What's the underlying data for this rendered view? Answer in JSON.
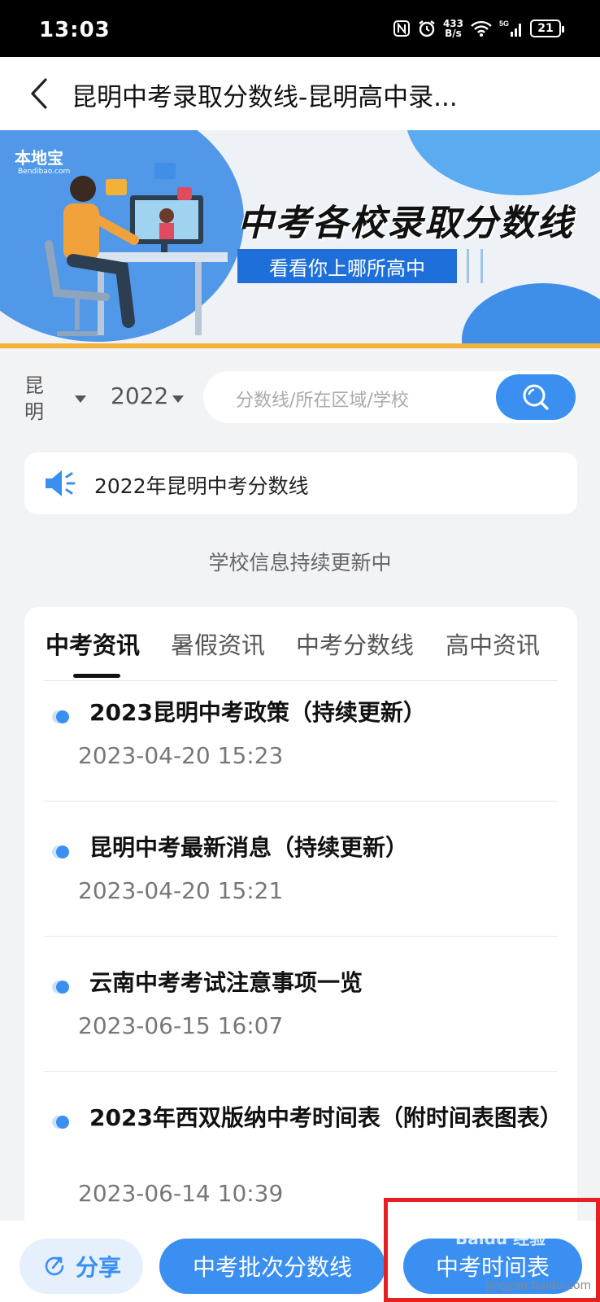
{
  "status_bar": {
    "time": "13:03",
    "net_speed_value": "433",
    "net_speed_unit": "B/s",
    "network": "5G",
    "battery": "21"
  },
  "header": {
    "title": "昆明中考录取分数线-昆明高中录..."
  },
  "banner": {
    "logo": "本地宝",
    "logo_sub": "Bendibao.com",
    "headline": "中考各校录取分数线",
    "subheadline": "看看你上哪所高中",
    "colors": {
      "primary": "#3a8ff0",
      "accent_stripe": "#f2b23a"
    }
  },
  "filters": {
    "city": "昆明",
    "year": "2022",
    "search_placeholder": "分数线/所在区域/学校"
  },
  "notice": {
    "text": "2022年昆明中考分数线"
  },
  "updating_text": "学校信息持续更新中",
  "tabs": [
    {
      "label": "中考资讯",
      "active": true
    },
    {
      "label": "暑假资讯",
      "active": false
    },
    {
      "label": "中考分数线",
      "active": false
    },
    {
      "label": "高中资讯",
      "active": false
    }
  ],
  "news": [
    {
      "title": "2023昆明中考政策（持续更新）",
      "date": "2023-04-20 15:23"
    },
    {
      "title": "昆明中考最新消息（持续更新）",
      "date": "2023-04-20 15:21"
    },
    {
      "title": "云南中考考试注意事项一览",
      "date": "2023-06-15 16:07"
    },
    {
      "title": "2023年西双版纳中考时间表（附时间表图表）",
      "date": "2023-06-14 10:39"
    }
  ],
  "bottom_bar": {
    "share": "分享",
    "batch_button": "中考批次分数线",
    "time_button": "中考时间表"
  },
  "watermark": {
    "text": "Baidu 经验",
    "url": "jingyan.baidu.com"
  }
}
